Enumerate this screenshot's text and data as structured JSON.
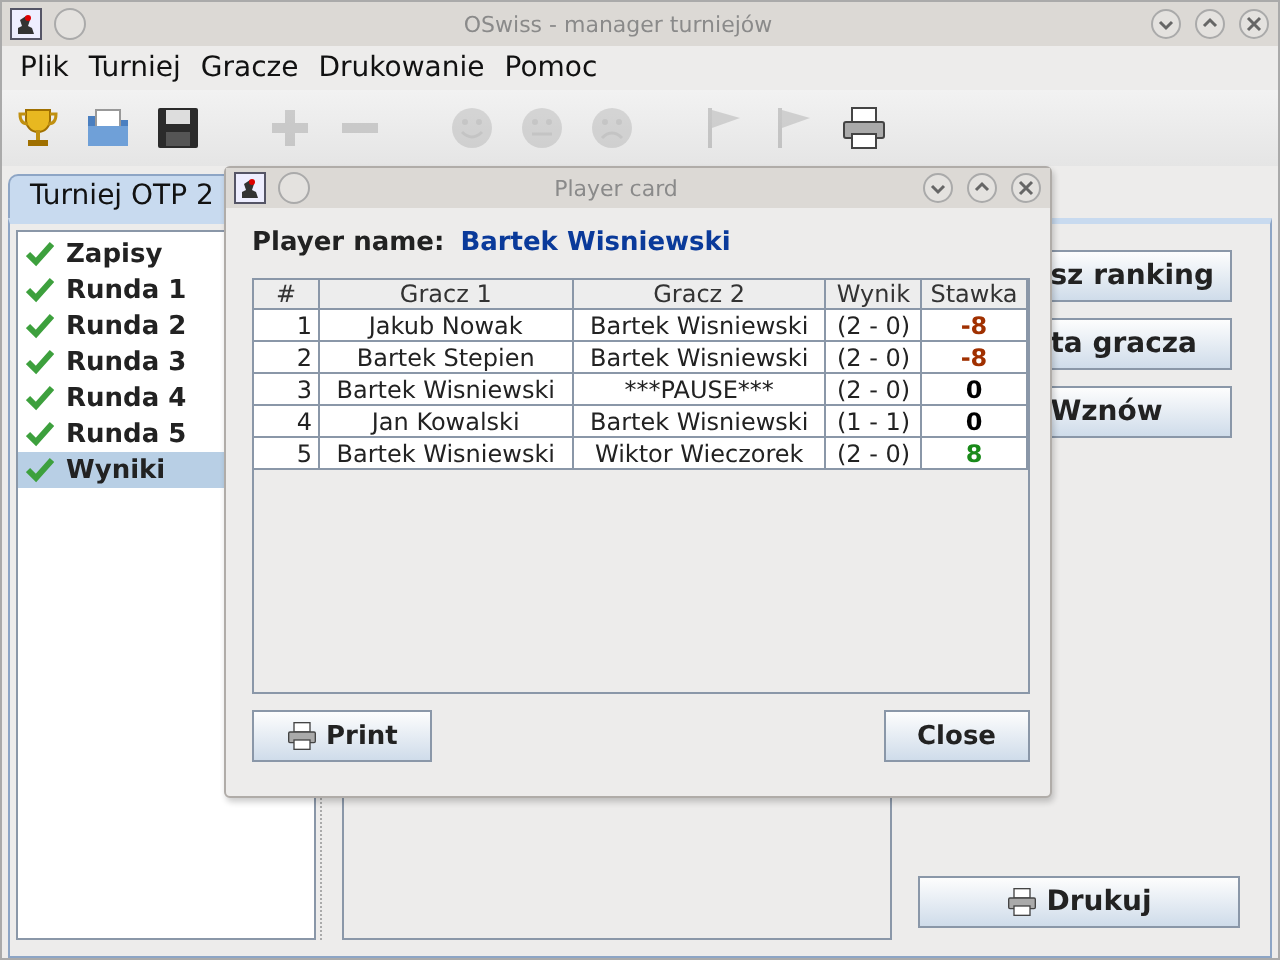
{
  "window": {
    "title": "OSwiss - manager turniejów"
  },
  "menu": [
    "Plik",
    "Turniej",
    "Gracze",
    "Drukowanie",
    "Pomoc"
  ],
  "toolbar": [
    {
      "kind": "trophy",
      "disabled": false
    },
    {
      "kind": "open",
      "disabled": false
    },
    {
      "kind": "save",
      "disabled": false
    },
    {
      "kind": "add",
      "disabled": true
    },
    {
      "kind": "remove",
      "disabled": true
    },
    {
      "kind": "smile",
      "disabled": true
    },
    {
      "kind": "neutral",
      "disabled": true
    },
    {
      "kind": "sad",
      "disabled": true
    },
    {
      "kind": "flag",
      "disabled": true
    },
    {
      "kind": "flag",
      "disabled": true
    },
    {
      "kind": "print",
      "disabled": false
    }
  ],
  "tab": {
    "label": "Turniej OTP 2"
  },
  "sidebar": {
    "items": [
      {
        "label": "Zapisy",
        "selected": false
      },
      {
        "label": "Runda 1",
        "selected": false
      },
      {
        "label": "Runda 2",
        "selected": false
      },
      {
        "label": "Runda 3",
        "selected": false
      },
      {
        "label": "Runda 4",
        "selected": false
      },
      {
        "label": "Runda 5",
        "selected": false
      },
      {
        "label": "Wyniki",
        "selected": true
      }
    ]
  },
  "right_buttons": [
    "sz ranking",
    "ta gracza",
    "Wznów"
  ],
  "print_button": "Drukuj",
  "dialog": {
    "title": "Player card",
    "player_label": "Player name:",
    "player_name": "Bartek Wisniewski",
    "table": {
      "columns": [
        "#",
        "Gracz 1",
        "Gracz 2",
        "Wynik",
        "Stawka"
      ],
      "rows": [
        {
          "cells": [
            "1",
            "Jakub Nowak",
            "Bartek Wisniewski",
            "(2 - 0)",
            "-8"
          ],
          "color": "#a03000"
        },
        {
          "cells": [
            "2",
            "Bartek Stepien",
            "Bartek Wisniewski",
            "(2 - 0)",
            "-8"
          ],
          "color": "#a03000"
        },
        {
          "cells": [
            "3",
            "Bartek Wisniewski",
            "***PAUSE***",
            "(2 - 0)",
            "0"
          ],
          "color": "#000000"
        },
        {
          "cells": [
            "4",
            "Jan Kowalski",
            "Bartek Wisniewski",
            "(1 - 1)",
            "0"
          ],
          "color": "#000000"
        },
        {
          "cells": [
            "5",
            "Bartek Wisniewski",
            "Wiktor Wieczorek",
            "(2 - 0)",
            "8"
          ],
          "color": "#1a8a1a"
        }
      ]
    },
    "buttons": [
      "Print",
      "Close"
    ]
  }
}
